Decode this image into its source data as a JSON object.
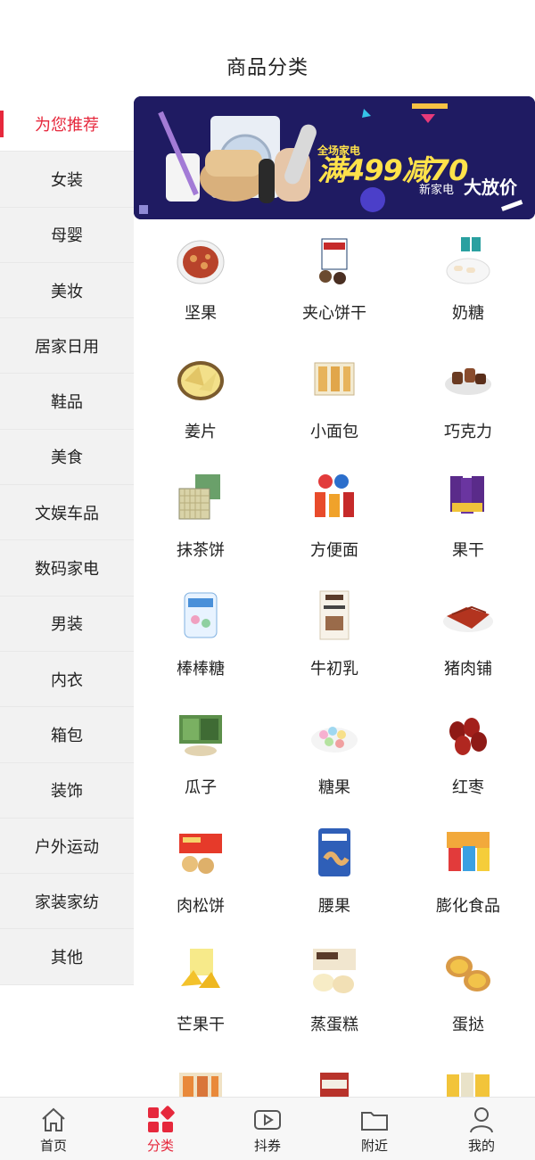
{
  "header": {
    "title": "商品分类"
  },
  "sidebar": {
    "items": [
      {
        "label": "为您推荐",
        "active": true
      },
      {
        "label": "女装"
      },
      {
        "label": "母婴"
      },
      {
        "label": "美妆"
      },
      {
        "label": "居家日用"
      },
      {
        "label": "鞋品"
      },
      {
        "label": "美食"
      },
      {
        "label": "文娱车品"
      },
      {
        "label": "数码家电"
      },
      {
        "label": "男装"
      },
      {
        "label": "内衣"
      },
      {
        "label": "箱包"
      },
      {
        "label": "装饰"
      },
      {
        "label": "户外运动"
      },
      {
        "label": "家装家纺"
      },
      {
        "label": "其他"
      }
    ]
  },
  "banner": {
    "small": "全场家电",
    "big": "满499减70",
    "sub_left": "新家电",
    "sub_right": "大放价"
  },
  "categories": [
    {
      "label": "坚果",
      "icon": "nuts-icon"
    },
    {
      "label": "夹心饼干",
      "icon": "sandwich-biscuit-icon"
    },
    {
      "label": "奶糖",
      "icon": "milk-candy-icon"
    },
    {
      "label": "姜片",
      "icon": "ginger-slice-icon"
    },
    {
      "label": "小面包",
      "icon": "bread-icon"
    },
    {
      "label": "巧克力",
      "icon": "chocolate-icon"
    },
    {
      "label": "抹茶饼",
      "icon": "matcha-cake-icon"
    },
    {
      "label": "方便面",
      "icon": "instant-noodle-icon"
    },
    {
      "label": "果干",
      "icon": "dried-fruit-icon"
    },
    {
      "label": "棒棒糖",
      "icon": "lollipop-icon"
    },
    {
      "label": "牛初乳",
      "icon": "colostrum-icon"
    },
    {
      "label": "猪肉铺",
      "icon": "pork-jerky-icon"
    },
    {
      "label": "瓜子",
      "icon": "seeds-icon"
    },
    {
      "label": "糖果",
      "icon": "candy-icon"
    },
    {
      "label": "红枣",
      "icon": "red-date-icon"
    },
    {
      "label": "肉松饼",
      "icon": "floss-cake-icon"
    },
    {
      "label": "腰果",
      "icon": "cashew-icon"
    },
    {
      "label": "膨化食品",
      "icon": "puffed-snack-icon"
    },
    {
      "label": "芒果干",
      "icon": "dried-mango-icon"
    },
    {
      "label": "蒸蛋糕",
      "icon": "steamed-cake-icon"
    },
    {
      "label": "蛋挞",
      "icon": "egg-tart-icon"
    }
  ],
  "tabbar": {
    "items": [
      {
        "label": "首页",
        "icon": "home-icon"
      },
      {
        "label": "分类",
        "icon": "category-icon",
        "active": true
      },
      {
        "label": "抖券",
        "icon": "video-coupon-icon"
      },
      {
        "label": "附近",
        "icon": "folder-icon"
      },
      {
        "label": "我的",
        "icon": "user-icon"
      }
    ]
  },
  "colors": {
    "accent": "#e6283c",
    "sidebar_bg": "#f2f2f2",
    "banner_bg": "#1f1b62"
  }
}
